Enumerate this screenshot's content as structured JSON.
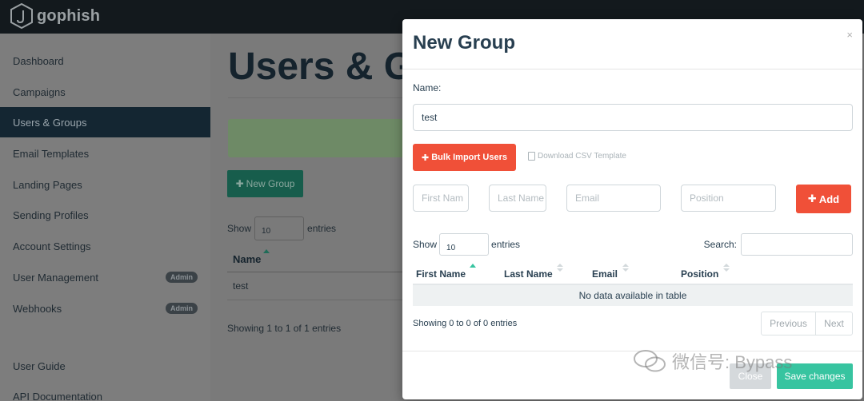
{
  "brand": {
    "name": "gophish"
  },
  "sidebar": {
    "items": [
      {
        "label": "Dashboard"
      },
      {
        "label": "Campaigns"
      },
      {
        "label": "Users & Groups"
      },
      {
        "label": "Email Templates"
      },
      {
        "label": "Landing Pages"
      },
      {
        "label": "Sending Profiles"
      },
      {
        "label": "Account Settings"
      },
      {
        "label": "User Management",
        "badge": "Admin"
      },
      {
        "label": "Webhooks",
        "badge": "Admin"
      },
      {
        "label": "User Guide"
      },
      {
        "label": "API Documentation"
      }
    ]
  },
  "main": {
    "title": "Users & G",
    "new_group_label": "New Group",
    "show_label": "Show",
    "entries_value": "10",
    "entries_label": "entries",
    "column_name": "Name",
    "rows": [
      "test"
    ],
    "info": "Showing 1 to 1 of 1 entries"
  },
  "modal": {
    "title": "New Group",
    "close_glyph": "×",
    "name_label": "Name:",
    "name_value": "test",
    "bulk_import_label": "Bulk Import Users",
    "csv_link_label": "Download CSV Template",
    "first_placeholder": "First Nam",
    "last_placeholder": "Last Name",
    "email_placeholder": "Email",
    "position_placeholder": "Position",
    "add_label": "Add",
    "show_label": "Show",
    "entries_value": "10",
    "entries_label": "entries",
    "search_label": "Search:",
    "columns": [
      "First Name",
      "Last Name",
      "Email",
      "Position"
    ],
    "empty_text": "No data available in table",
    "info": "Showing 0 to 0 of 0 entries",
    "prev_label": "Previous",
    "next_label": "Next",
    "close_label": "Close",
    "save_label": "Save changes"
  },
  "watermark": {
    "text": "微信号: Bypass"
  },
  "colors": {
    "navbar": "#13191d",
    "accent_green": "#37c4a0",
    "danger_red": "#f05038",
    "heading": "#283f50"
  }
}
